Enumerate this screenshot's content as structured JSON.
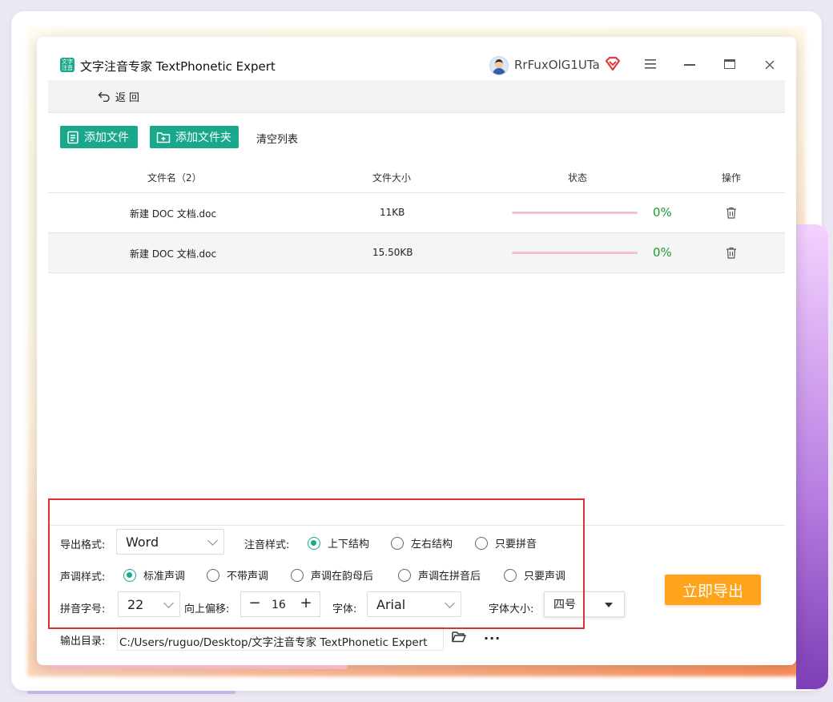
{
  "app": {
    "title": "文字注音专家 TextPhonetic Expert",
    "logo_text": "文字\n注音",
    "username": "RrFuxOlG1UTa"
  },
  "backbar": {
    "back_label": "返回"
  },
  "toolbar": {
    "add_file": "添加文件",
    "add_folder": "添加文件夹",
    "clear_list": "清空列表"
  },
  "table": {
    "headers": [
      "文件名（2）",
      "文件大小",
      "状态",
      "操作"
    ],
    "rows": [
      {
        "name": "新建 DOC 文档.doc",
        "size": "11KB",
        "progress": 0,
        "percent": "0%"
      },
      {
        "name": "新建 DOC 文档.doc",
        "size": "15.50KB",
        "progress": 0,
        "percent": "0%"
      }
    ]
  },
  "settings": {
    "export_format_label": "导出格式:",
    "export_format_value": "Word",
    "annotation_style_label": "注音样式:",
    "annotation_styles": [
      "上下结构",
      "左右结构",
      "只要拼音"
    ],
    "annotation_selected": 0,
    "tone_style_label": "声调样式:",
    "tone_styles": [
      "标准声调",
      "不带声调",
      "声调在韵母后",
      "声调在拼音后",
      "只要声调"
    ],
    "tone_selected": 0,
    "pinyin_size_label": "拼音字号:",
    "pinyin_size_value": "22",
    "offset_label": "向上偏移:",
    "offset_value": "16",
    "offset_minus": "−",
    "offset_plus": "+",
    "font_label": "字体:",
    "font_value": "Arial",
    "font_size_label": "字体大小:",
    "font_size_value": "四号",
    "output_dir_label": "输出目录:",
    "output_dir_value": "C:/Users/ruguo/Desktop/文字注音专家 TextPhonetic Expert",
    "more_label": "···"
  },
  "export_button": "立即导出",
  "colors": {
    "accent_green": "#19a88c",
    "export_orange": "#ffa31a",
    "percent_green": "#1f9b2e",
    "highlight_red": "#e03131"
  }
}
